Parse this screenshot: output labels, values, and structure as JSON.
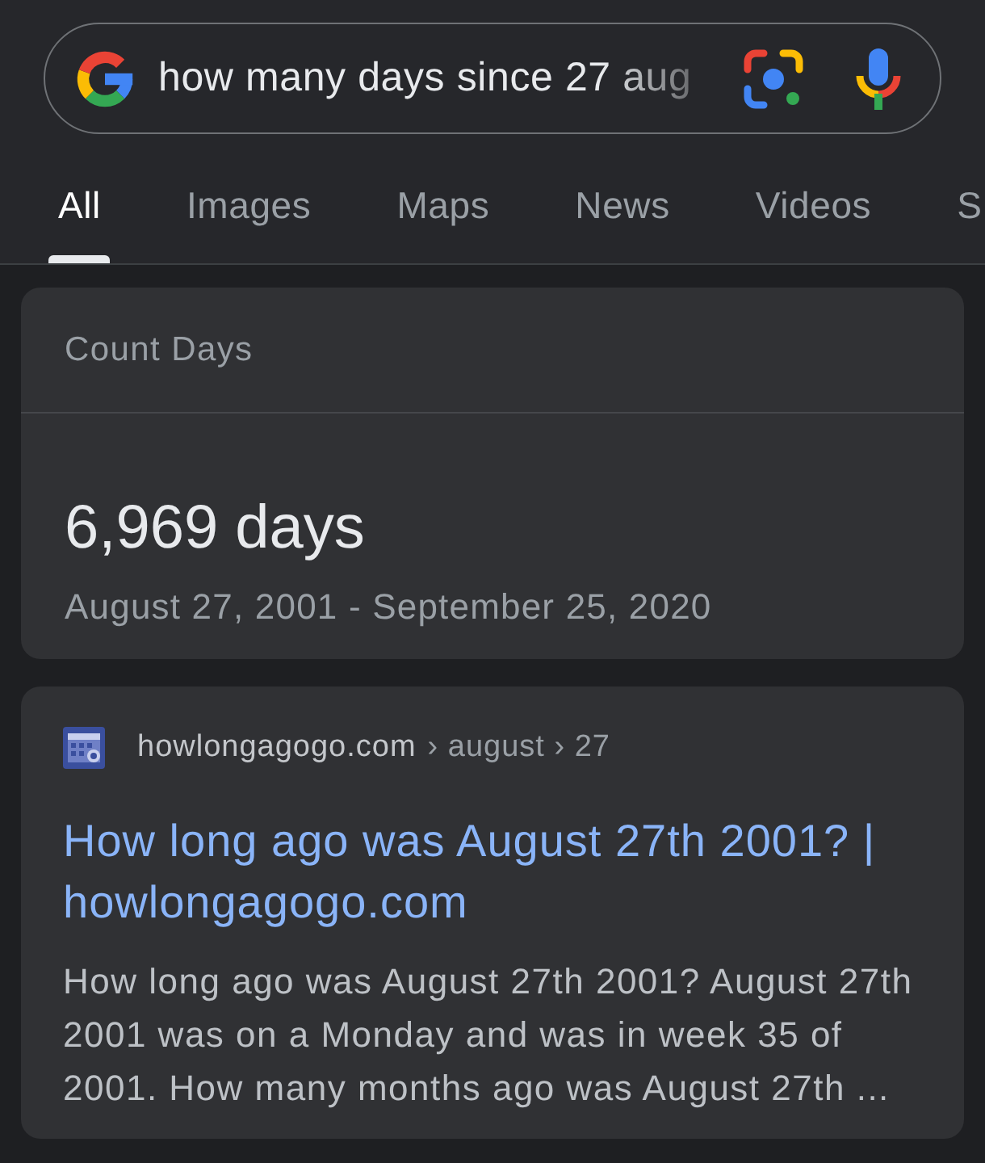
{
  "search": {
    "query": "how many days since 27 aug"
  },
  "tabs": [
    {
      "label": "All",
      "selected": true
    },
    {
      "label": "Images",
      "selected": false
    },
    {
      "label": "Maps",
      "selected": false
    },
    {
      "label": "News",
      "selected": false
    },
    {
      "label": "Videos",
      "selected": false
    },
    {
      "label": "S",
      "selected": false
    }
  ],
  "answer_card": {
    "title": "Count Days",
    "result": "6,969 days",
    "range": "August 27, 2001 - September 25, 2020"
  },
  "results": [
    {
      "domain": "howlongagogo.com",
      "path": "› august › 27",
      "title": "How long ago was August 27th 2001? | howlongagogo.com",
      "snippet": "How long ago was August 27th 2001? August 27th 2001 was on a Monday and was in week 35 of 2001. How many months ago was August 27th ..."
    }
  ]
}
